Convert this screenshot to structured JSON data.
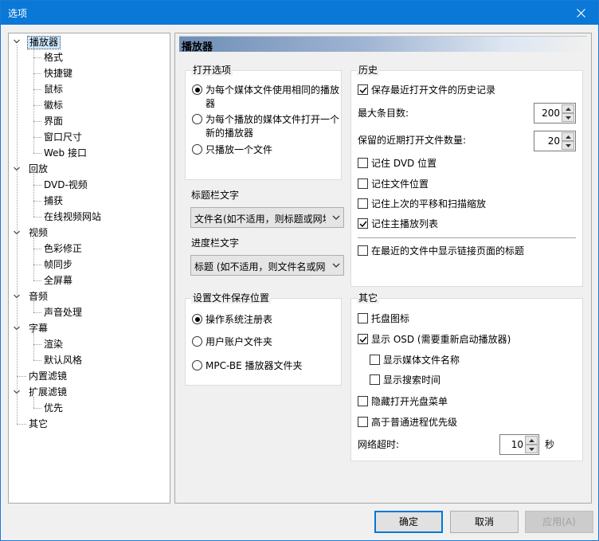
{
  "window": {
    "title": "选项"
  },
  "tree": {
    "items": [
      {
        "label": "播放器",
        "level": 0,
        "expanded": true,
        "selected": true
      },
      {
        "label": "格式",
        "level": 1
      },
      {
        "label": "快捷键",
        "level": 1
      },
      {
        "label": "鼠标",
        "level": 1
      },
      {
        "label": "徽标",
        "level": 1
      },
      {
        "label": "界面",
        "level": 1
      },
      {
        "label": "窗口尺寸",
        "level": 1
      },
      {
        "label": "Web 接口",
        "level": 1
      },
      {
        "label": "回放",
        "level": 0,
        "expanded": true
      },
      {
        "label": "DVD-视频",
        "level": 1
      },
      {
        "label": "捕获",
        "level": 1
      },
      {
        "label": "在线视频网站",
        "level": 1
      },
      {
        "label": "视频",
        "level": 0,
        "expanded": true
      },
      {
        "label": "色彩修正",
        "level": 1
      },
      {
        "label": "帧同步",
        "level": 1
      },
      {
        "label": "全屏幕",
        "level": 1
      },
      {
        "label": "音频",
        "level": 0,
        "expanded": true
      },
      {
        "label": "声音处理",
        "level": 1
      },
      {
        "label": "字幕",
        "level": 0,
        "expanded": true
      },
      {
        "label": "渲染",
        "level": 1
      },
      {
        "label": "默认风格",
        "level": 1
      },
      {
        "label": "内置滤镜",
        "level": 0
      },
      {
        "label": "扩展滤镜",
        "level": 0,
        "expanded": true
      },
      {
        "label": "优先",
        "level": 1
      },
      {
        "label": "其它",
        "level": 0
      }
    ]
  },
  "page": {
    "header": "播放器"
  },
  "open_options": {
    "title": "打开选项",
    "options": [
      {
        "label": "为每个媒体文件使用相同的播放器",
        "checked": true
      },
      {
        "label": "为每个播放的媒体文件打开一个新的播放器",
        "checked": false
      },
      {
        "label": "只播放一个文件",
        "checked": false
      }
    ]
  },
  "title_bar_text": {
    "title": "标题栏文字",
    "value": "文件名(如不适用，则标题或网址)"
  },
  "seek_bar_text": {
    "title": "进度栏文字",
    "value": "标题 (如不适用，则文件名或网址)"
  },
  "settings_location": {
    "title": "设置文件保存位置",
    "options": [
      {
        "label": "操作系统注册表",
        "checked": true
      },
      {
        "label": "用户账户文件夹",
        "checked": false
      },
      {
        "label": "MPC-BE 播放器文件夹",
        "checked": false
      }
    ]
  },
  "history": {
    "title": "历史",
    "keep_history": {
      "label": "保存最近打开文件的历史记录",
      "checked": true
    },
    "max_entries": {
      "label": "最大条目数:",
      "value": "200"
    },
    "recent_count": {
      "label": "保留的近期打开文件数量:",
      "value": "20"
    },
    "remember_dvd": {
      "label": "记住 DVD 位置",
      "checked": false
    },
    "remember_file": {
      "label": "记住文件位置",
      "checked": false
    },
    "remember_pan": {
      "label": "记住上次的平移和扫描缩放",
      "checked": false
    },
    "remember_playlist": {
      "label": "记住主播放列表",
      "checked": true
    },
    "show_link_title": {
      "label": "在最近的文件中显示链接页面的标题",
      "checked": false
    }
  },
  "other": {
    "title": "其它",
    "tray_icon": {
      "label": "托盘图标",
      "checked": false
    },
    "show_osd": {
      "label": "显示 OSD (需要重新启动播放器)",
      "checked": true
    },
    "osd_filename": {
      "label": "显示媒体文件名称",
      "checked": false
    },
    "osd_seektime": {
      "label": "显示搜索时间",
      "checked": false
    },
    "hide_cd_menu": {
      "label": "隐藏打开光盘菜单",
      "checked": false
    },
    "high_priority": {
      "label": "高于普通进程优先级",
      "checked": false
    },
    "net_timeout": {
      "label": "网络超时:",
      "value": "10",
      "unit": "秒"
    }
  },
  "buttons": {
    "ok": "确定",
    "cancel": "取消",
    "apply": "应用(A)"
  },
  "colors": {
    "titlebar": "#0a78d7",
    "selection": "#cce8ff",
    "header_gradient": "#6f8eb6"
  }
}
